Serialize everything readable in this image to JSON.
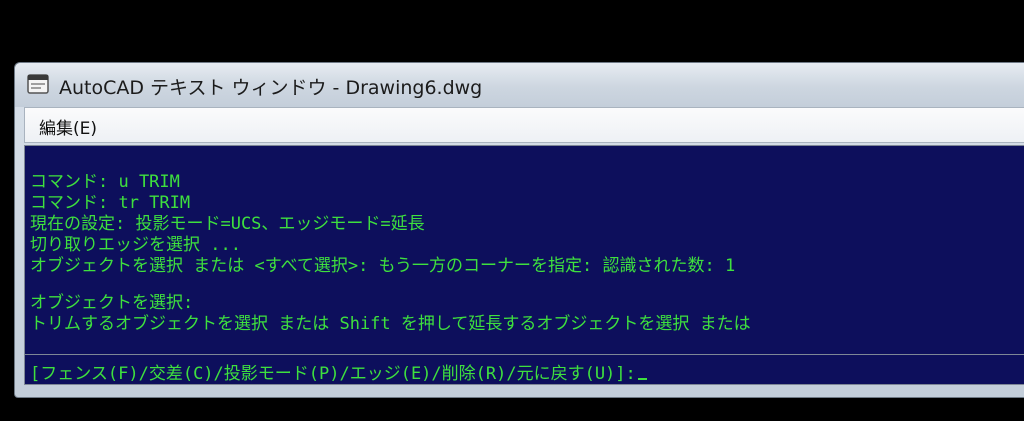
{
  "window": {
    "title": "AutoCAD テキスト ウィンドウ - Drawing6.dwg",
    "icon": "autocad-text-window-icon"
  },
  "menu": {
    "items": [
      {
        "label": "編集(E)"
      }
    ]
  },
  "console": {
    "lines": [
      "コマンド: u TRIM",
      "コマンド: tr TRIM",
      "現在の設定: 投影モード=UCS、エッジモード=延長",
      "切り取りエッジを選択 ...",
      "オブジェクトを選択 または <すべて選択>: もう一方のコーナーを指定: 認識された数: 1",
      "",
      "オブジェクトを選択:",
      "トリムするオブジェクトを選択 または Shift を押して延長するオブジェクトを選択 または"
    ],
    "prompt": "[フェンス(F)/交差(C)/投影モード(P)/エッジ(E)/削除(R)/元に戻す(U)]:"
  },
  "colors": {
    "console_background": "#0d0f5c",
    "console_text": "#3ee03e",
    "desktop": "#000000"
  }
}
